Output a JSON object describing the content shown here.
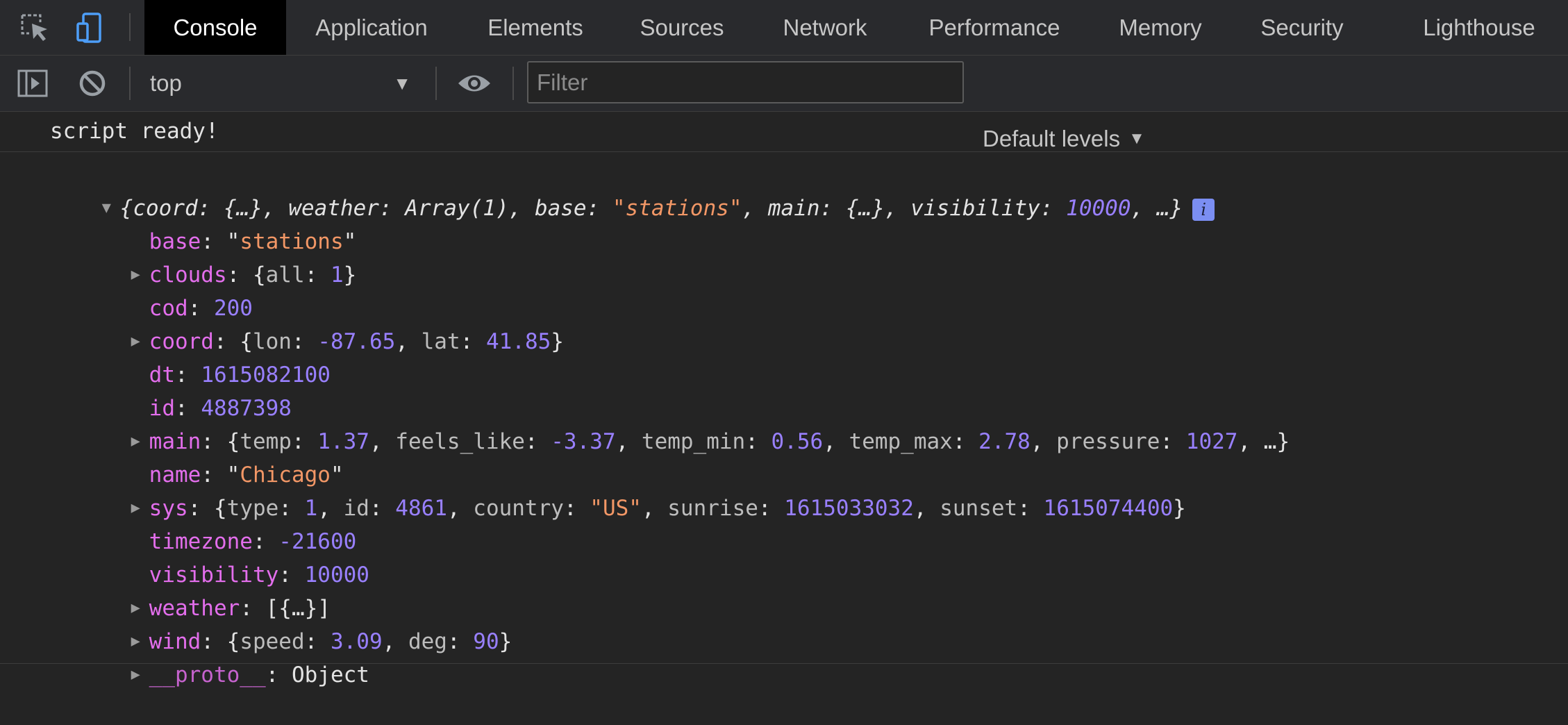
{
  "tabs": [
    {
      "label": "Console",
      "active": true
    },
    {
      "label": "Application"
    },
    {
      "label": "Elements"
    },
    {
      "label": "Sources"
    },
    {
      "label": "Network"
    },
    {
      "label": "Performance"
    },
    {
      "label": "Memory"
    },
    {
      "label": "Security"
    },
    {
      "label": "Lighthouse"
    }
  ],
  "toolbar": {
    "context": "top",
    "filter_placeholder": "Filter",
    "filter_value": "",
    "levels": "Default levels"
  },
  "icons": {
    "inspect": "inspect-element-icon",
    "device": "device-toggle-icon",
    "sidebar": "show-sidebar-icon",
    "clear": "clear-console-icon",
    "eye": "live-expression-icon",
    "info": "info-icon"
  },
  "colors": {
    "key": "#e36eec",
    "string": "#f29766",
    "number": "#9980ff",
    "background": "#242424",
    "accent": "#7b8ef2"
  },
  "console": {
    "message": "script ready!",
    "object": {
      "summary": {
        "coord": "coord",
        "coord_val": "{…}",
        "weather": "weather",
        "weather_val": "Array(1)",
        "base": "base",
        "base_val": "\"stations\"",
        "main": "main",
        "main_val": "{…}",
        "visibility": "visibility",
        "visibility_val": "10000",
        "ellipsis": "…}",
        "info": "i"
      },
      "props": {
        "base": {
          "key": "base",
          "value": "stations"
        },
        "clouds": {
          "key": "clouds",
          "all_key": "all",
          "all": "1"
        },
        "cod": {
          "key": "cod",
          "value": "200"
        },
        "coord": {
          "key": "coord",
          "lon_key": "lon",
          "lon": "-87.65",
          "lat_key": "lat",
          "lat": "41.85"
        },
        "dt": {
          "key": "dt",
          "value": "1615082100"
        },
        "id": {
          "key": "id",
          "value": "4887398"
        },
        "main": {
          "key": "main",
          "temp_key": "temp",
          "temp": "1.37",
          "feels_key": "feels_like",
          "feels": "-3.37",
          "tmin_key": "temp_min",
          "tmin": "0.56",
          "tmax_key": "temp_max",
          "tmax": "2.78",
          "pressure_key": "pressure",
          "pressure": "1027"
        },
        "name": {
          "key": "name",
          "value": "Chicago"
        },
        "sys": {
          "key": "sys",
          "type_key": "type",
          "type": "1",
          "id_key": "id",
          "id": "4861",
          "country_key": "country",
          "country": "US",
          "sunrise_key": "sunrise",
          "sunrise": "1615033032",
          "sunset_key": "sunset",
          "sunset": "1615074400"
        },
        "timezone": {
          "key": "timezone",
          "value": "-21600"
        },
        "visibility": {
          "key": "visibility",
          "value": "10000"
        },
        "weather": {
          "key": "weather",
          "value": "[{…}]"
        },
        "wind": {
          "key": "wind",
          "speed_key": "speed",
          "speed": "3.09",
          "deg_key": "deg",
          "deg": "90"
        },
        "proto": {
          "key": "__proto__",
          "value": "Object"
        }
      }
    }
  }
}
